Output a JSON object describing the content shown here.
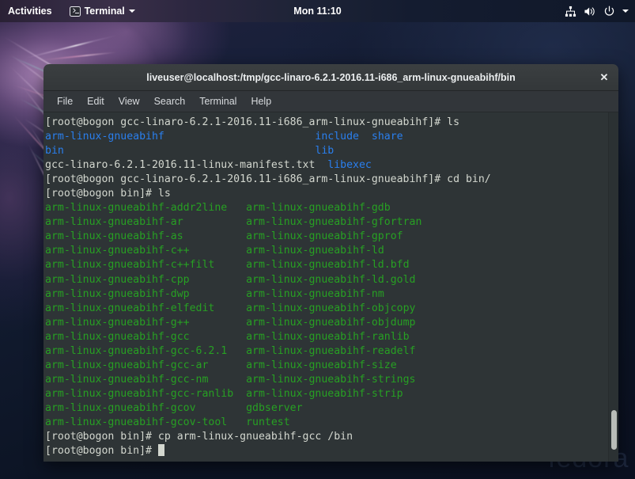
{
  "topbar": {
    "activities_label": "Activities",
    "app_icon": "terminal-icon",
    "app_name": "Terminal",
    "app_menu_caret": "chevron-down-icon",
    "clock": "Mon 11:10",
    "tray_icons": [
      "network-wired-icon",
      "volume-icon",
      "power-icon",
      "chevron-down-icon"
    ]
  },
  "desktop": {
    "watermark": "fedora"
  },
  "window": {
    "title": "liveuser@localhost:/tmp/gcc-linaro-6.2.1-2016.11-i686_arm-linux-gnueabihf/bin",
    "close_label": "✕",
    "menus": [
      "File",
      "Edit",
      "View",
      "Search",
      "Terminal",
      "Help"
    ]
  },
  "terminal": {
    "colors": {
      "background": "#2e3436",
      "foreground": "#d3d7cf",
      "directory_blue": "#2a7fee",
      "executable_green": "#27a023"
    },
    "lines": [
      {
        "id": "l1",
        "segments": [
          {
            "t": "[root@bogon gcc-linaro-6.2.1-2016.11-i686_arm-linux-gnueabihf]# ls",
            "c": "white"
          }
        ]
      },
      {
        "id": "l2",
        "segments": [
          {
            "t": "arm-linux-gnueabihf",
            "c": "blue"
          },
          {
            "t": "                        ",
            "c": "white"
          },
          {
            "t": "include",
            "c": "blue"
          },
          {
            "t": "  ",
            "c": "white"
          },
          {
            "t": "share",
            "c": "blue"
          }
        ]
      },
      {
        "id": "l3",
        "segments": [
          {
            "t": "bin",
            "c": "blue"
          },
          {
            "t": "                                        ",
            "c": "white"
          },
          {
            "t": "lib",
            "c": "blue"
          }
        ]
      },
      {
        "id": "l4",
        "segments": [
          {
            "t": "gcc-linaro-6.2.1-2016.11-linux-manifest.txt",
            "c": "white"
          },
          {
            "t": "  ",
            "c": "white"
          },
          {
            "t": "libexec",
            "c": "blue"
          }
        ]
      },
      {
        "id": "l5",
        "segments": [
          {
            "t": "[root@bogon gcc-linaro-6.2.1-2016.11-i686_arm-linux-gnueabihf]# cd bin/",
            "c": "white"
          }
        ]
      },
      {
        "id": "l6",
        "segments": [
          {
            "t": "[root@bogon bin]# ls",
            "c": "white"
          }
        ]
      },
      {
        "id": "l7",
        "segments": [
          {
            "t": "arm-linux-gnueabihf-addr2line",
            "c": "green"
          },
          {
            "t": "   ",
            "c": "white"
          },
          {
            "t": "arm-linux-gnueabihf-gdb",
            "c": "green"
          }
        ]
      },
      {
        "id": "l8",
        "segments": [
          {
            "t": "arm-linux-gnueabihf-ar",
            "c": "green"
          },
          {
            "t": "          ",
            "c": "white"
          },
          {
            "t": "arm-linux-gnueabihf-gfortran",
            "c": "green"
          }
        ]
      },
      {
        "id": "l9",
        "segments": [
          {
            "t": "arm-linux-gnueabihf-as",
            "c": "green"
          },
          {
            "t": "          ",
            "c": "white"
          },
          {
            "t": "arm-linux-gnueabihf-gprof",
            "c": "green"
          }
        ]
      },
      {
        "id": "l10",
        "segments": [
          {
            "t": "arm-linux-gnueabihf-c++",
            "c": "green"
          },
          {
            "t": "         ",
            "c": "white"
          },
          {
            "t": "arm-linux-gnueabihf-ld",
            "c": "green"
          }
        ]
      },
      {
        "id": "l11",
        "segments": [
          {
            "t": "arm-linux-gnueabihf-c++filt",
            "c": "green"
          },
          {
            "t": "     ",
            "c": "white"
          },
          {
            "t": "arm-linux-gnueabihf-ld.bfd",
            "c": "green"
          }
        ]
      },
      {
        "id": "l12",
        "segments": [
          {
            "t": "arm-linux-gnueabihf-cpp",
            "c": "green"
          },
          {
            "t": "         ",
            "c": "white"
          },
          {
            "t": "arm-linux-gnueabihf-ld.gold",
            "c": "green"
          }
        ]
      },
      {
        "id": "l13",
        "segments": [
          {
            "t": "arm-linux-gnueabihf-dwp",
            "c": "green"
          },
          {
            "t": "         ",
            "c": "white"
          },
          {
            "t": "arm-linux-gnueabihf-nm",
            "c": "green"
          }
        ]
      },
      {
        "id": "l14",
        "segments": [
          {
            "t": "arm-linux-gnueabihf-elfedit",
            "c": "green"
          },
          {
            "t": "     ",
            "c": "white"
          },
          {
            "t": "arm-linux-gnueabihf-objcopy",
            "c": "green"
          }
        ]
      },
      {
        "id": "l15",
        "segments": [
          {
            "t": "arm-linux-gnueabihf-g++",
            "c": "green"
          },
          {
            "t": "         ",
            "c": "white"
          },
          {
            "t": "arm-linux-gnueabihf-objdump",
            "c": "green"
          }
        ]
      },
      {
        "id": "l16",
        "segments": [
          {
            "t": "arm-linux-gnueabihf-gcc",
            "c": "green"
          },
          {
            "t": "         ",
            "c": "white"
          },
          {
            "t": "arm-linux-gnueabihf-ranlib",
            "c": "green"
          }
        ]
      },
      {
        "id": "l17",
        "segments": [
          {
            "t": "arm-linux-gnueabihf-gcc-6.2.1",
            "c": "green"
          },
          {
            "t": "   ",
            "c": "white"
          },
          {
            "t": "arm-linux-gnueabihf-readelf",
            "c": "green"
          }
        ]
      },
      {
        "id": "l18",
        "segments": [
          {
            "t": "arm-linux-gnueabihf-gcc-ar",
            "c": "green"
          },
          {
            "t": "      ",
            "c": "white"
          },
          {
            "t": "arm-linux-gnueabihf-size",
            "c": "green"
          }
        ]
      },
      {
        "id": "l19",
        "segments": [
          {
            "t": "arm-linux-gnueabihf-gcc-nm",
            "c": "green"
          },
          {
            "t": "      ",
            "c": "white"
          },
          {
            "t": "arm-linux-gnueabihf-strings",
            "c": "green"
          }
        ]
      },
      {
        "id": "l20",
        "segments": [
          {
            "t": "arm-linux-gnueabihf-gcc-ranlib",
            "c": "green"
          },
          {
            "t": "  ",
            "c": "white"
          },
          {
            "t": "arm-linux-gnueabihf-strip",
            "c": "green"
          }
        ]
      },
      {
        "id": "l21",
        "segments": [
          {
            "t": "arm-linux-gnueabihf-gcov",
            "c": "green"
          },
          {
            "t": "        ",
            "c": "white"
          },
          {
            "t": "gdbserver",
            "c": "green"
          }
        ]
      },
      {
        "id": "l22",
        "segments": [
          {
            "t": "arm-linux-gnueabihf-gcov-tool",
            "c": "green"
          },
          {
            "t": "   ",
            "c": "white"
          },
          {
            "t": "runtest",
            "c": "green"
          }
        ]
      },
      {
        "id": "l23",
        "segments": [
          {
            "t": "[root@bogon bin]# cp arm-linux-gnueabihf-gcc /bin",
            "c": "white"
          }
        ]
      },
      {
        "id": "l24",
        "segments": [
          {
            "t": "[root@bogon bin]# ",
            "c": "white"
          },
          {
            "t": "",
            "c": "cursor"
          }
        ]
      }
    ]
  }
}
